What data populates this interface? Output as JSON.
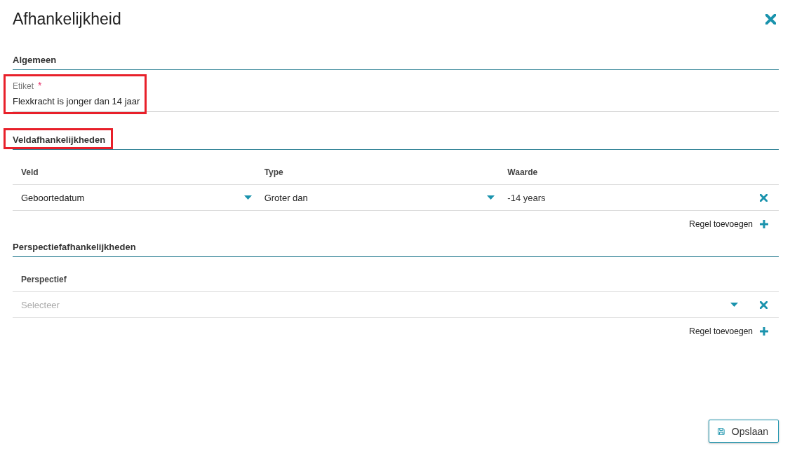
{
  "window": {
    "title": "Afhankelijkheid"
  },
  "general": {
    "heading": "Algemeen",
    "highlighted": false,
    "field": {
      "label": "Etiket",
      "required_mark": "*",
      "value": "Flexkracht is jonger dan 14 jaar",
      "highlighted": true
    }
  },
  "field_dependencies": {
    "heading": "Veldafhankelijkheden",
    "highlighted": true,
    "columns": [
      "Veld",
      "Type",
      "Waarde"
    ],
    "rows": [
      {
        "cells": [
          {
            "kind": "select",
            "value": "Geboortedatum"
          },
          {
            "kind": "select",
            "value": "Groter dan"
          },
          {
            "kind": "text",
            "value": "-14 years"
          }
        ]
      }
    ],
    "add_label": "Regel toevoegen"
  },
  "perspective_dependencies": {
    "heading": "Perspectiefafhankelijkheden",
    "highlighted": false,
    "columns": [
      "Perspectief"
    ],
    "rows": [
      {
        "cells": [
          {
            "kind": "select",
            "placeholder": "Selecteer"
          }
        ]
      }
    ],
    "add_label": "Regel toevoegen"
  },
  "save_button": "Opslaan"
}
